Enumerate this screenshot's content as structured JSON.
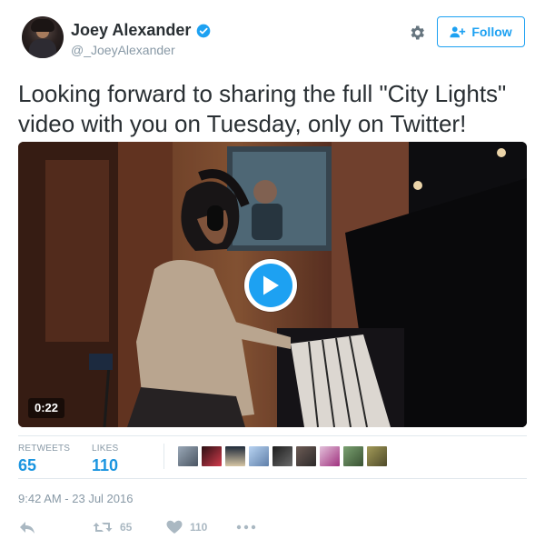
{
  "user": {
    "display_name": "Joey Alexander",
    "handle": "@_JoeyAlexander"
  },
  "follow_button": {
    "label": "Follow"
  },
  "tweet": {
    "text_line1": "Looking forward to sharing the full \"City Lights\"",
    "text_line2": "video with you on Tuesday, only on Twitter!"
  },
  "video": {
    "duration": "0:22"
  },
  "stats": {
    "retweets_label": "RETWEETS",
    "retweets_count": "65",
    "likes_label": "LIKES",
    "likes_count": "110"
  },
  "timestamp": "9:42 AM - 23 Jul 2016",
  "actions": {
    "retweet_count": "65",
    "like_count": "110"
  },
  "colors": {
    "accent": "#1da1f2",
    "stat_blue": "#1b95e0",
    "muted": "#8899a6",
    "action_gray": "#aab8c2",
    "text": "#292f33"
  },
  "icons": {
    "verified": "verified-badge-icon",
    "settings": "gear-icon",
    "follow": "add-user-icon",
    "play": "play-icon",
    "reply": "reply-icon",
    "retweet": "retweet-icon",
    "like": "heart-icon",
    "more": "more-dots-icon"
  }
}
